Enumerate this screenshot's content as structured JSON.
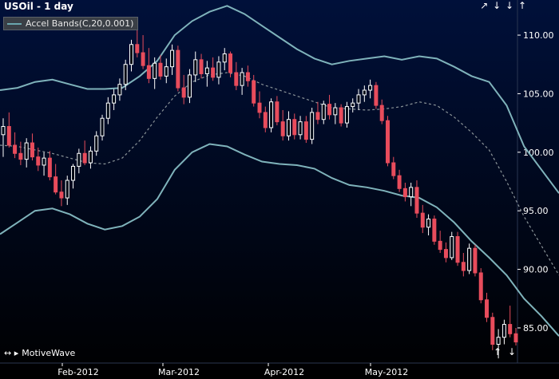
{
  "header": {
    "title": "USOil - 1 day"
  },
  "legend": {
    "label": "Accel Bands(C,20,0.001)"
  },
  "nav": {
    "top_right": [
      "↗",
      "↓",
      "↓",
      "↑"
    ],
    "bottom_right": [
      "↑",
      "↓"
    ],
    "bottom_left": "↔",
    "bottom_left_arrows": "↔ ▸",
    "brand": "MotiveWave"
  },
  "colors": {
    "background_top": "#00103a",
    "background_bottom": "#000000",
    "up_candle": "#ffffff",
    "down_candle": "#e84c5c",
    "band": "#7fb3bb",
    "middle": "#8a9498",
    "axis_text": "#ffffff"
  },
  "chart_data": {
    "type": "candlestick",
    "title": "USOil - 1 day",
    "ylim": [
      82,
      113
    ],
    "yticks": [
      "85.00",
      "90.00",
      "95.00",
      "100.00",
      "105.00",
      "110.00"
    ],
    "xticks": [
      "Feb-2012",
      "Mar-2012",
      "Apr-2012",
      "May-2012"
    ],
    "series": [
      {
        "name": "Accel Bands(C,20,0.001)",
        "kind": "upper_band",
        "values": [
          105.3,
          105.5,
          106.0,
          106.2,
          105.8,
          105.4,
          105.4,
          105.5,
          106.5,
          107.8,
          110.0,
          111.2,
          112.0,
          112.5,
          111.8,
          110.8,
          109.8,
          108.8,
          108.0,
          107.5,
          107.8,
          108.0,
          108.2,
          107.9,
          108.2,
          108.0,
          107.3,
          106.5,
          106.0,
          104.0,
          100.5,
          98.5,
          96.5
        ]
      },
      {
        "kind": "middle",
        "values": [
          100.6,
          100.5,
          100.2,
          99.9,
          99.5,
          99.1,
          99.0,
          99.5,
          101.0,
          103.0,
          104.8,
          106.0,
          106.6,
          106.8,
          106.5,
          105.8,
          105.3,
          104.8,
          104.3,
          103.8,
          103.7,
          103.6,
          103.7,
          103.9,
          104.3,
          104.0,
          103.0,
          101.7,
          100.2,
          97.5,
          94.5,
          92.0,
          89.5
        ]
      },
      {
        "kind": "lower_band",
        "values": [
          93.0,
          94.0,
          95.0,
          95.2,
          94.7,
          93.9,
          93.4,
          93.7,
          94.5,
          96.0,
          98.5,
          100.0,
          100.7,
          100.5,
          99.8,
          99.2,
          99.0,
          98.9,
          98.6,
          97.8,
          97.2,
          97.0,
          96.7,
          96.3,
          96.1,
          95.3,
          94.0,
          92.4,
          91.0,
          89.5,
          87.5,
          86.0,
          84.3
        ]
      }
    ],
    "candles": [
      [
        101.5,
        102.9,
        99.6,
        102.2
      ],
      [
        102.2,
        103.4,
        100.4,
        100.6
      ],
      [
        100.6,
        101.7,
        99.5,
        99.9
      ],
      [
        99.9,
        100.9,
        98.9,
        99.4
      ],
      [
        99.4,
        101.2,
        98.7,
        100.8
      ],
      [
        100.8,
        101.6,
        99.3,
        99.6
      ],
      [
        99.6,
        100.4,
        98.4,
        98.9
      ],
      [
        98.9,
        100.0,
        98.0,
        99.5
      ],
      [
        99.5,
        100.1,
        97.6,
        97.9
      ],
      [
        97.9,
        99.0,
        96.4,
        96.6
      ],
      [
        96.6,
        97.6,
        95.4,
        96.1
      ],
      [
        96.1,
        98.0,
        95.5,
        97.6
      ],
      [
        97.6,
        99.0,
        96.9,
        98.8
      ],
      [
        98.8,
        100.3,
        98.2,
        99.9
      ],
      [
        99.9,
        101.0,
        98.9,
        99.1
      ],
      [
        99.1,
        100.5,
        98.6,
        100.1
      ],
      [
        100.1,
        101.8,
        99.7,
        101.4
      ],
      [
        101.4,
        103.2,
        101.0,
        102.9
      ],
      [
        102.9,
        104.7,
        102.4,
        104.2
      ],
      [
        104.2,
        105.4,
        103.6,
        104.9
      ],
      [
        104.9,
        106.3,
        104.4,
        105.8
      ],
      [
        105.8,
        107.9,
        105.3,
        107.5
      ],
      [
        107.5,
        109.6,
        106.9,
        109.2
      ],
      [
        109.2,
        110.8,
        108.1,
        108.5
      ],
      [
        108.5,
        110.0,
        107.1,
        107.4
      ],
      [
        107.4,
        108.9,
        105.9,
        106.3
      ],
      [
        106.3,
        108.1,
        105.4,
        107.6
      ],
      [
        107.6,
        108.3,
        106.2,
        106.5
      ],
      [
        106.5,
        108.0,
        105.9,
        107.3
      ],
      [
        107.3,
        109.2,
        106.6,
        108.7
      ],
      [
        108.7,
        109.1,
        105.2,
        105.5
      ],
      [
        105.5,
        106.6,
        104.1,
        104.7
      ],
      [
        104.7,
        107.1,
        104.2,
        106.6
      ],
      [
        106.6,
        108.6,
        106.0,
        107.9
      ],
      [
        107.9,
        108.4,
        106.3,
        106.7
      ],
      [
        106.7,
        107.8,
        105.6,
        107.2
      ],
      [
        107.2,
        108.1,
        106.1,
        106.4
      ],
      [
        106.4,
        108.2,
        105.8,
        107.7
      ],
      [
        107.7,
        108.9,
        107.0,
        108.4
      ],
      [
        108.4,
        108.6,
        106.4,
        106.8
      ],
      [
        106.8,
        107.7,
        105.3,
        105.7
      ],
      [
        105.7,
        107.2,
        104.9,
        106.8
      ],
      [
        106.8,
        107.4,
        105.6,
        106.1
      ],
      [
        106.1,
        106.6,
        103.9,
        104.2
      ],
      [
        104.2,
        105.2,
        102.9,
        103.4
      ],
      [
        103.4,
        103.9,
        101.7,
        102.1
      ],
      [
        102.1,
        104.6,
        101.7,
        104.3
      ],
      [
        104.3,
        104.8,
        102.3,
        102.6
      ],
      [
        102.6,
        103.6,
        101.0,
        101.4
      ],
      [
        101.4,
        103.5,
        101.0,
        102.8
      ],
      [
        102.8,
        103.3,
        101.1,
        101.5
      ],
      [
        101.5,
        103.1,
        101.1,
        102.6
      ],
      [
        102.6,
        103.1,
        100.8,
        101.1
      ],
      [
        101.1,
        103.8,
        100.7,
        103.4
      ],
      [
        103.4,
        104.3,
        102.4,
        102.8
      ],
      [
        102.8,
        104.4,
        102.4,
        104.1
      ],
      [
        104.1,
        104.9,
        102.8,
        103.2
      ],
      [
        103.2,
        104.2,
        102.4,
        103.8
      ],
      [
        103.8,
        104.1,
        102.2,
        102.5
      ],
      [
        102.5,
        104.3,
        102.1,
        103.9
      ],
      [
        103.9,
        104.6,
        103.4,
        104.2
      ],
      [
        104.2,
        105.4,
        103.6,
        104.9
      ],
      [
        104.9,
        105.7,
        104.3,
        105.3
      ],
      [
        105.3,
        106.2,
        104.6,
        105.7
      ],
      [
        105.7,
        106.0,
        103.7,
        104.0
      ],
      [
        104.0,
        104.5,
        102.4,
        102.7
      ],
      [
        102.7,
        103.1,
        98.8,
        99.1
      ],
      [
        99.1,
        99.6,
        97.7,
        98.0
      ],
      [
        98.0,
        98.5,
        96.6,
        96.9
      ],
      [
        96.9,
        97.4,
        95.8,
        96.2
      ],
      [
        96.2,
        97.4,
        95.4,
        97.0
      ],
      [
        97.0,
        97.6,
        94.4,
        94.8
      ],
      [
        94.8,
        95.5,
        93.1,
        93.6
      ],
      [
        93.6,
        94.7,
        92.9,
        94.3
      ],
      [
        94.3,
        94.6,
        92.1,
        92.4
      ],
      [
        92.4,
        93.3,
        91.4,
        91.7
      ],
      [
        91.7,
        92.3,
        90.6,
        91.0
      ],
      [
        91.0,
        93.2,
        90.8,
        92.8
      ],
      [
        92.8,
        93.2,
        90.3,
        90.6
      ],
      [
        90.6,
        91.4,
        89.4,
        89.9
      ],
      [
        89.9,
        92.2,
        89.6,
        91.8
      ],
      [
        91.8,
        92.1,
        89.4,
        89.7
      ],
      [
        89.7,
        90.1,
        87.1,
        87.4
      ],
      [
        87.4,
        88.0,
        85.5,
        85.9
      ],
      [
        85.9,
        86.3,
        83.1,
        83.6
      ],
      [
        83.6,
        84.9,
        82.4,
        84.2
      ],
      [
        84.2,
        85.7,
        83.6,
        85.3
      ],
      [
        85.3,
        86.9,
        84.2,
        84.5
      ],
      [
        84.5,
        85.0,
        83.5,
        83.8
      ]
    ]
  }
}
